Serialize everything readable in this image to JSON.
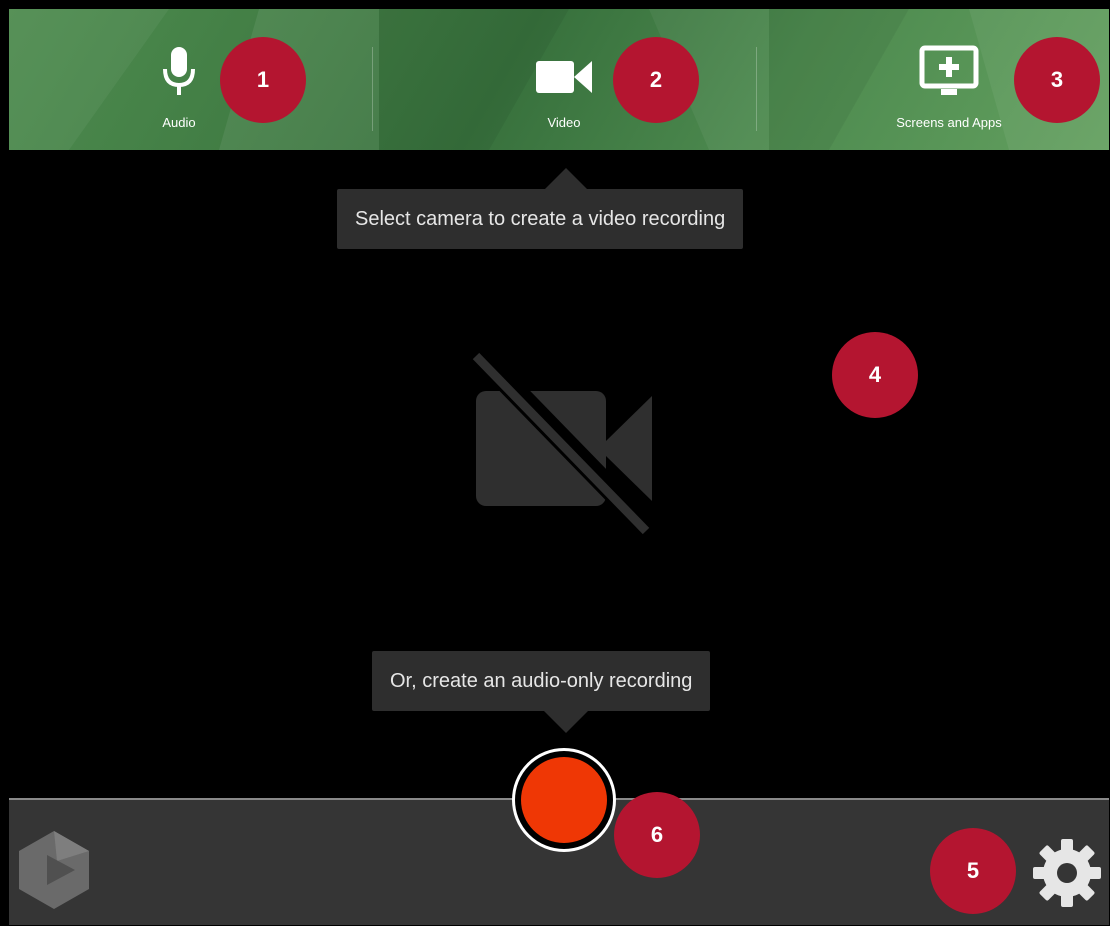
{
  "sources": {
    "audio": {
      "label": "Audio",
      "icon": "microphone-icon"
    },
    "video": {
      "label": "Video",
      "icon": "video-camera-icon"
    },
    "screens": {
      "label": "Screens and Apps",
      "icon": "screen-add-icon"
    }
  },
  "preview": {
    "camera_hint": "Select camera to create a video recording",
    "audio_hint": "Or, create an audio-only recording",
    "placeholder_icon": "camera-off-icon"
  },
  "controls": {
    "record_icon": "record-icon",
    "settings_icon": "gear-icon",
    "logo_icon": "panopto-logo-icon"
  },
  "callouts": [
    "1",
    "2",
    "3",
    "4",
    "5",
    "6"
  ],
  "colors": {
    "header_green": "#3f7a42",
    "record_red": "#ef3705",
    "callout_red": "#b41530",
    "footer_gray": "#353535",
    "tooltip_gray": "#2e2e2e"
  }
}
